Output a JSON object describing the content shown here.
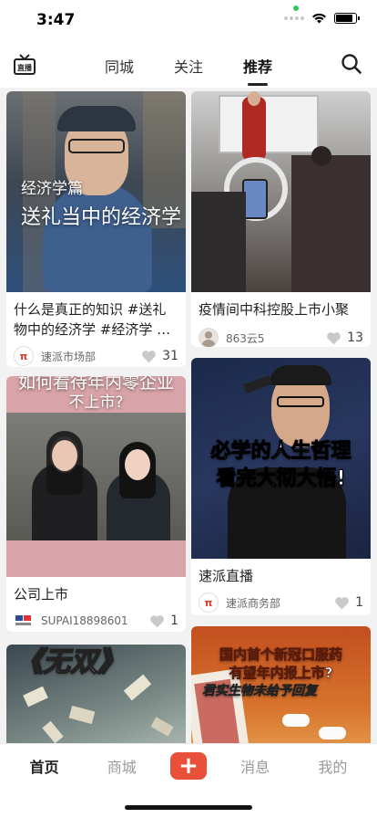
{
  "status": {
    "time": "3:47"
  },
  "nav": {
    "tabs": [
      {
        "label": "同城"
      },
      {
        "label": "关注"
      },
      {
        "label": "推荐"
      }
    ],
    "active_tab": "推荐",
    "logo_icon": "live-tv-icon",
    "logo_text": "直播"
  },
  "feed": {
    "cards": [
      {
        "title": "什么是真正的知识 #送礼物中的经济学 #经济学 #商...",
        "overlay_small": "经济学篇",
        "overlay_big": "送礼当中的经济学",
        "author": "速派市场部",
        "likes": "31"
      },
      {
        "title": "疫情间中科控股上市小聚",
        "author": "863云5",
        "likes": "13"
      },
      {
        "title": "公司上市",
        "overlay_top_1": "如何看待年内零企业",
        "overlay_top_2": "不上市?",
        "author": "SUPAI18898601",
        "likes": "1"
      },
      {
        "title": "速派直播",
        "overlay_line_1": "必学的人生哲理",
        "overlay_line_2": "看完大彻大悟!",
        "author": "速派商务部",
        "likes": "1"
      },
      {
        "overlay_text": "《无双》"
      },
      {
        "overlay_line_1": "国内首个新冠口服药",
        "overlay_line_2": "有望年内报上市?",
        "overlay_line_3": "君实生物未给予回复"
      }
    ]
  },
  "tabbar": {
    "items": [
      {
        "label": "首页"
      },
      {
        "label": "商城"
      },
      {
        "label": "+"
      },
      {
        "label": "消息"
      },
      {
        "label": "我的"
      }
    ],
    "accent": "#e8503a"
  }
}
